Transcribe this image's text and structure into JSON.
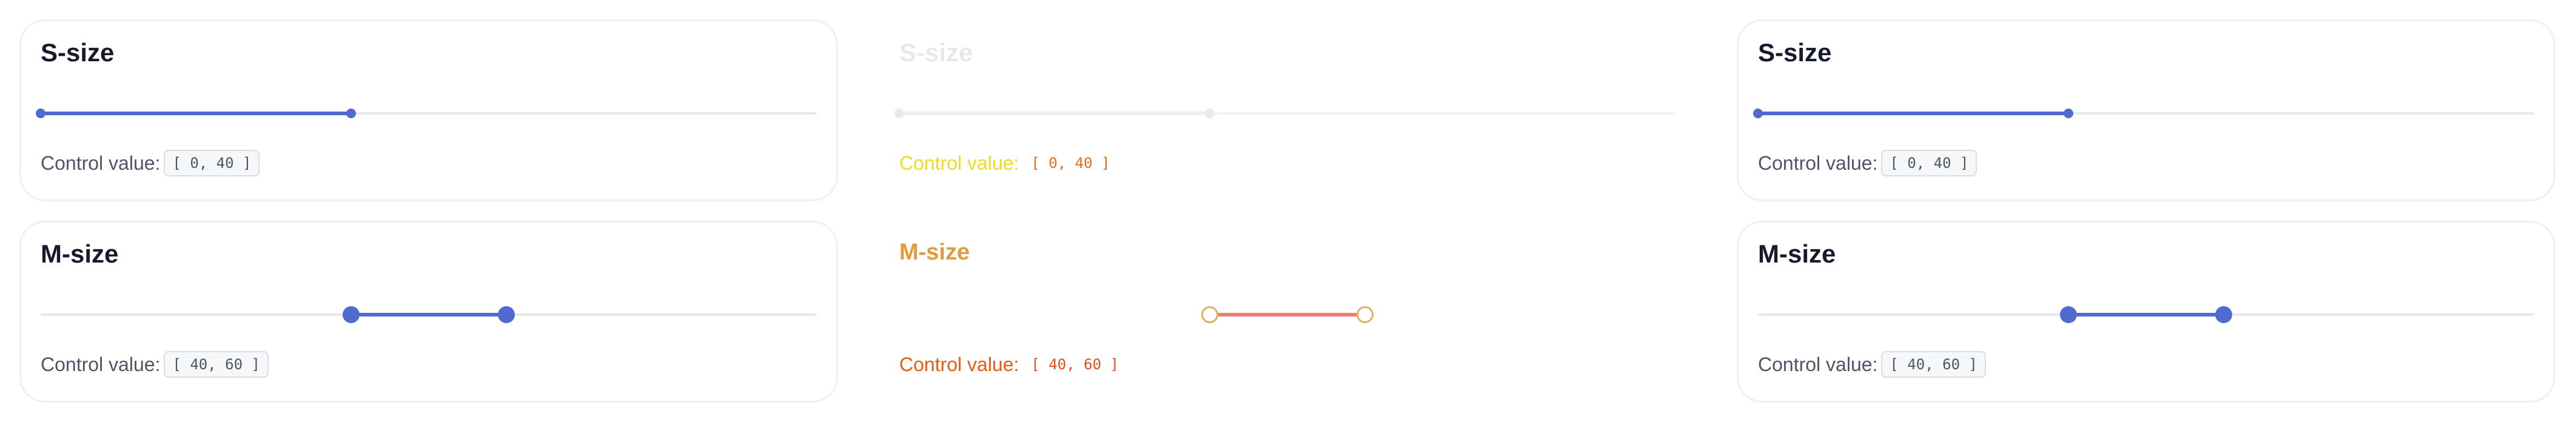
{
  "panels": [
    {
      "id": "left",
      "cards": [
        {
          "title": "S-size",
          "control_label": "Control value:",
          "value_text": "[ 0, 40 ]",
          "range": [
            0,
            40
          ]
        },
        {
          "title": "M-size",
          "control_label": "Control value:",
          "value_text": "[ 40, 60 ]",
          "range": [
            40,
            60
          ]
        }
      ]
    },
    {
      "id": "middle",
      "cards": [
        {
          "title": "S-size",
          "control_label": "Control value:",
          "value_text": "[ 0, 40 ]",
          "range": [
            0,
            40
          ]
        },
        {
          "title": "M-size",
          "control_label": "Control value:",
          "value_text": "[ 40, 60 ]",
          "range": [
            40,
            60
          ]
        }
      ]
    },
    {
      "id": "right",
      "cards": [
        {
          "title": "S-size",
          "control_label": "Control value:",
          "value_text": "[ 0, 40 ]",
          "range": [
            0,
            40
          ]
        },
        {
          "title": "M-size",
          "control_label": "Control value:",
          "value_text": "[ 40, 60 ]",
          "range": [
            40,
            60
          ]
        }
      ]
    }
  ],
  "colors": {
    "accent": "#4f6bd0",
    "rail": "#e6e8ec",
    "title": "#171a2b",
    "muted_text": "#4e5566"
  }
}
